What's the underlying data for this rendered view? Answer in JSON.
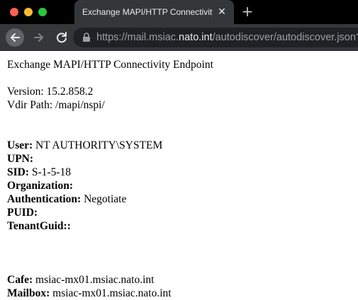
{
  "browser": {
    "tab_title": "Exchange MAPI/HTTP Connectivity",
    "tab_close_glyph": "✕",
    "new_tab_glyph": "+",
    "url_scheme": "https://",
    "url_subdomain": "mail.msiac.",
    "url_host": "nato.int",
    "url_path": "/autodiscover/autodiscover.json?"
  },
  "page": {
    "heading": "Exchange MAPI/HTTP Connectivity Endpoint",
    "version_line": "Version: 15.2.858.2",
    "vdir_line": "Vdir Path: /mapi/nspi/",
    "identity": [
      {
        "label": "User:",
        "value": " NT AUTHORITY\\SYSTEM"
      },
      {
        "label": "UPN:",
        "value": ""
      },
      {
        "label": "SID:",
        "value": " S-1-5-18"
      },
      {
        "label": "Organization:",
        "value": ""
      },
      {
        "label": "Authentication:",
        "value": " Negotiate"
      },
      {
        "label": "PUID:",
        "value": ""
      },
      {
        "label": "TenantGuid::",
        "value": ""
      }
    ],
    "servers": [
      {
        "label": "Cafe:",
        "value": " msiac-mx01.msiac.nato.int"
      },
      {
        "label": "Mailbox:",
        "value": " msiac-mx01.msiac.nato.int"
      }
    ]
  },
  "colors": {
    "close": "#fe5f57",
    "minimize": "#febc2e",
    "maximize": "#28c840",
    "chrome": "#35363a"
  }
}
